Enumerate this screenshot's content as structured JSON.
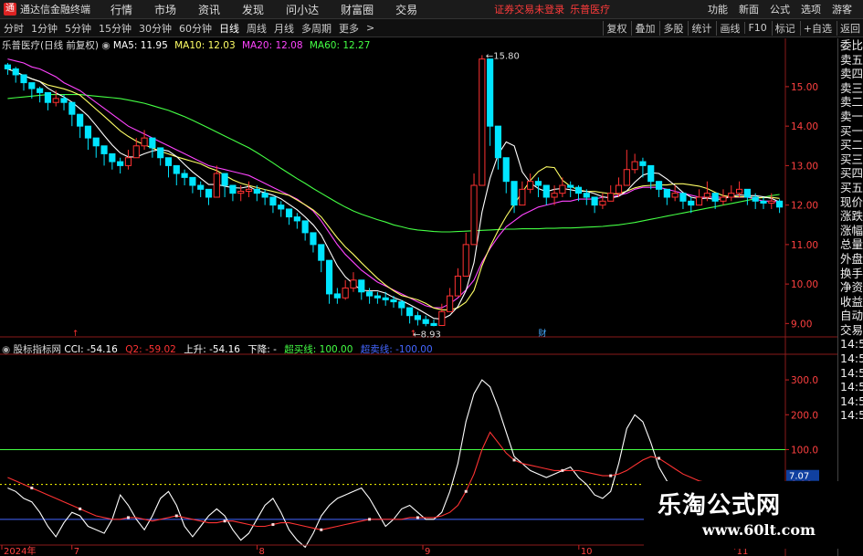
{
  "titlebar": {
    "app_name": "通达信金融终端",
    "menu": [
      "行情",
      "市场",
      "资讯",
      "发现",
      "问小达",
      "财富圈",
      "交易"
    ],
    "notice": "证券交易未登录",
    "stock_link": "乐普医疗",
    "right_items": [
      "功能",
      "新面",
      "公式",
      "选项",
      "游客"
    ]
  },
  "toolbar": {
    "periods": [
      "分时",
      "1分钟",
      "5分钟",
      "15分钟",
      "30分钟",
      "60分钟",
      "日线",
      "周线",
      "月线",
      "多周期",
      "更多"
    ],
    "active_period": "日线",
    "right_items": [
      "复权",
      "叠加",
      "多股",
      "统计",
      "画线",
      "F10",
      "标记",
      "+自选",
      "返回"
    ]
  },
  "ma_legend": {
    "title": "乐普医疗(日线 前复权)",
    "items": [
      {
        "text": "MA5: 11.95",
        "color": "#ffffff"
      },
      {
        "text": "MA10: 12.03",
        "color": "#ffff66"
      },
      {
        "text": "MA20: 12.08",
        "color": "#ff44ff"
      },
      {
        "text": "MA60: 12.27",
        "color": "#44ff44"
      }
    ]
  },
  "cci_legend": {
    "title": "股标指标网",
    "items": [
      {
        "text": "CCI: -54.16",
        "color": "#ffffff"
      },
      {
        "text": "Q2: -59.02",
        "color": "#ff3333"
      },
      {
        "text": "上升: -54.16",
        "color": "#ffffff"
      },
      {
        "text": "下降: -",
        "color": "#ffffff"
      },
      {
        "text": "超买线: 100.00",
        "color": "#44ff44"
      },
      {
        "text": "超卖线: -100.00",
        "color": "#4466ff"
      }
    ]
  },
  "price_axis": [
    "15.00",
    "14.00",
    "13.00",
    "12.00",
    "11.00",
    "10.00",
    "9.00"
  ],
  "cci_axis": [
    "300.0",
    "200.0",
    "100.0",
    "0.00"
  ],
  "cci_cursor_value": "7.07",
  "annotations": {
    "high": "15.80",
    "low": "8.93"
  },
  "date_axis": [
    "2024年",
    "7",
    "8",
    "9",
    "10",
    "11"
  ],
  "markers": {
    "m1": "↑",
    "m2": "财"
  },
  "right_panel": [
    "委比",
    "卖五",
    "卖四",
    "卖三",
    "卖二",
    "卖一",
    "买一",
    "买二",
    "买三",
    "买四",
    "买五",
    "现价",
    "涨跌",
    "涨幅",
    "总量",
    "外盘",
    "换手",
    "净资",
    "收益",
    "自动",
    "交易",
    "14:50",
    "14:50",
    "14:50",
    "14:50",
    "14:50",
    "14:50"
  ],
  "watermark": {
    "big": "乐淘公式网",
    "small": "www.60lt.com"
  },
  "colors": {
    "up": "#ff3232",
    "down": "#00e5ff",
    "ma5": "#ffffff",
    "ma10": "#ffff66",
    "ma20": "#ff44ff",
    "ma60": "#44ff44"
  },
  "chart_data": [
    {
      "type": "candlestick",
      "title": "乐普医疗(日线 前复权)",
      "ylim": [
        8.8,
        15.9
      ],
      "yticks": [
        9,
        10,
        11,
        12,
        13,
        14,
        15
      ],
      "x_month_labels": [
        "2024年",
        "7",
        "8",
        "9",
        "10",
        "11"
      ],
      "close": [
        15.45,
        15.3,
        15.1,
        14.95,
        14.85,
        14.6,
        14.7,
        14.6,
        14.3,
        14.0,
        13.7,
        13.5,
        13.3,
        13.1,
        13.0,
        13.2,
        13.5,
        13.7,
        13.45,
        13.2,
        13.0,
        12.8,
        12.7,
        12.5,
        12.4,
        12.2,
        12.8,
        12.5,
        12.3,
        12.35,
        12.4,
        12.3,
        12.2,
        12.0,
        11.9,
        11.7,
        11.6,
        11.3,
        11.0,
        10.6,
        9.75,
        9.65,
        9.9,
        10.1,
        9.8,
        9.7,
        9.65,
        9.6,
        9.55,
        9.4,
        9.2,
        9.1,
        9.0,
        8.95,
        9.3,
        9.7,
        10.2,
        11.0,
        12.5,
        15.7,
        14.0,
        13.2,
        12.6,
        12.0,
        12.4,
        12.6,
        12.5,
        12.2,
        12.3,
        12.5,
        12.45,
        12.3,
        12.2,
        12.0,
        12.1,
        12.3,
        12.5,
        12.9,
        13.1,
        13.0,
        12.6,
        12.4,
        12.2,
        12.3,
        12.1,
        12.0,
        12.2,
        12.3,
        12.1,
        12.2,
        12.3,
        12.4,
        12.2,
        12.1,
        12.05,
        12.1,
        11.95
      ],
      "high": [
        15.6,
        15.5,
        15.3,
        15.1,
        15.0,
        14.8,
        14.9,
        14.8,
        14.5,
        14.2,
        13.9,
        13.7,
        13.5,
        13.3,
        13.2,
        13.4,
        13.7,
        13.9,
        13.6,
        13.4,
        13.2,
        13.0,
        12.9,
        12.7,
        12.6,
        12.4,
        13.0,
        12.7,
        12.5,
        12.5,
        12.6,
        12.5,
        12.4,
        12.2,
        12.1,
        11.9,
        11.8,
        11.5,
        11.2,
        10.8,
        10.0,
        9.9,
        10.1,
        10.3,
        10.0,
        9.9,
        9.8,
        9.8,
        9.7,
        9.6,
        9.4,
        9.3,
        9.2,
        9.1,
        9.5,
        9.9,
        10.4,
        11.3,
        12.8,
        15.8,
        15.0,
        13.5,
        12.9,
        12.4,
        12.6,
        12.8,
        12.7,
        12.5,
        12.5,
        12.7,
        12.6,
        12.5,
        12.4,
        12.2,
        12.3,
        12.5,
        12.7,
        13.4,
        13.3,
        13.2,
        12.8,
        12.6,
        12.4,
        12.5,
        12.3,
        12.2,
        12.4,
        12.6,
        12.3,
        12.4,
        12.5,
        12.6,
        12.4,
        12.3,
        12.2,
        12.3,
        12.15
      ],
      "low": [
        15.3,
        15.1,
        14.9,
        14.7,
        14.6,
        14.4,
        14.5,
        14.4,
        14.0,
        13.7,
        13.4,
        13.2,
        13.0,
        12.9,
        12.8,
        12.9,
        13.2,
        13.4,
        13.2,
        13.0,
        12.7,
        12.5,
        12.5,
        12.3,
        12.2,
        12.0,
        12.4,
        12.2,
        12.1,
        12.1,
        12.2,
        12.1,
        12.0,
        11.8,
        11.7,
        11.5,
        11.4,
        11.1,
        10.8,
        10.3,
        9.5,
        9.5,
        9.6,
        9.8,
        9.6,
        9.5,
        9.5,
        9.45,
        9.4,
        9.2,
        9.0,
        8.95,
        8.93,
        8.93,
        9.1,
        9.4,
        9.9,
        10.6,
        11.5,
        12.5,
        13.5,
        12.9,
        12.3,
        11.8,
        12.0,
        12.3,
        12.2,
        12.0,
        12.0,
        12.2,
        12.2,
        12.1,
        12.0,
        11.8,
        11.9,
        12.1,
        12.2,
        12.7,
        12.8,
        12.7,
        12.4,
        12.2,
        12.0,
        12.1,
        11.9,
        11.8,
        12.0,
        12.1,
        11.9,
        12.0,
        12.1,
        12.2,
        12.0,
        11.9,
        11.9,
        11.9,
        11.8
      ],
      "ma20": [
        15.7,
        15.65,
        15.6,
        15.5,
        15.45,
        15.35,
        15.25,
        15.1,
        15.0,
        14.9,
        14.75,
        14.6,
        14.45,
        14.3,
        14.15,
        14.0,
        13.9,
        13.8,
        13.7,
        13.6,
        13.5,
        13.4,
        13.3,
        13.2,
        13.1,
        13.0,
        12.95,
        12.9,
        12.85,
        12.8,
        12.75,
        12.65,
        12.55,
        12.45,
        12.35,
        12.25,
        12.15,
        12.0,
        11.85,
        11.6,
        11.3,
        11.0,
        10.75,
        10.55,
        10.35,
        10.2,
        10.05,
        9.95,
        9.85,
        9.75,
        9.65,
        9.55,
        9.45,
        9.4,
        9.4,
        9.5,
        9.65,
        9.85,
        10.1,
        10.55,
        10.9,
        11.2,
        11.45,
        11.6,
        11.75,
        11.85,
        11.95,
        12.0,
        12.05,
        12.1,
        12.1,
        12.15,
        12.15,
        12.15,
        12.2,
        12.2,
        12.25,
        12.3,
        12.4,
        12.45,
        12.45,
        12.45,
        12.4,
        12.35,
        12.3,
        12.25,
        12.2,
        12.2,
        12.2,
        12.2,
        12.2,
        12.2,
        12.2,
        12.15,
        12.1,
        12.1,
        12.08
      ],
      "ma60": [
        14.7,
        14.72,
        14.74,
        14.76,
        14.78,
        14.8,
        14.8,
        14.8,
        14.8,
        14.8,
        14.78,
        14.76,
        14.74,
        14.72,
        14.7,
        14.66,
        14.62,
        14.58,
        14.52,
        14.46,
        14.4,
        14.32,
        14.24,
        14.15,
        14.05,
        13.95,
        13.85,
        13.75,
        13.65,
        13.55,
        13.45,
        13.33,
        13.2,
        13.07,
        12.93,
        12.8,
        12.67,
        12.55,
        12.42,
        12.3,
        12.18,
        12.06,
        11.95,
        11.85,
        11.77,
        11.7,
        11.63,
        11.57,
        11.5,
        11.45,
        11.4,
        11.37,
        11.35,
        11.33,
        11.32,
        11.32,
        11.33,
        11.34,
        11.35,
        11.36,
        11.37,
        11.38,
        11.39,
        11.39,
        11.4,
        11.4,
        11.4,
        11.41,
        11.41,
        11.42,
        11.42,
        11.43,
        11.44,
        11.45,
        11.46,
        11.48,
        11.5,
        11.53,
        11.56,
        11.6,
        11.64,
        11.68,
        11.72,
        11.76,
        11.8,
        11.84,
        11.88,
        11.92,
        11.96,
        12.0,
        12.04,
        12.08,
        12.12,
        12.16,
        12.2,
        12.24,
        12.27
      ]
    },
    {
      "type": "line",
      "title": "股标指标网",
      "ylim": [
        -200,
        350
      ],
      "yticks": [
        300,
        200,
        100,
        0
      ],
      "series": [
        {
          "name": "CCI",
          "color": "#ffffff",
          "values": [
            -10,
            -20,
            -40,
            -50,
            -80,
            -120,
            -150,
            -110,
            -80,
            -90,
            -120,
            -130,
            -140,
            -100,
            -30,
            -60,
            -100,
            -130,
            -90,
            -40,
            -20,
            -60,
            -120,
            -150,
            -120,
            -90,
            -70,
            -90,
            -130,
            -160,
            -140,
            -100,
            -60,
            -40,
            -80,
            -130,
            -160,
            -180,
            -140,
            -90,
            -60,
            -40,
            -30,
            -20,
            -10,
            -40,
            -80,
            -120,
            -100,
            -70,
            -60,
            -80,
            -100,
            -100,
            -80,
            -20,
            60,
            180,
            260,
            300,
            280,
            220,
            150,
            80,
            60,
            40,
            30,
            20,
            30,
            40,
            50,
            20,
            0,
            -30,
            -40,
            -20,
            60,
            160,
            200,
            180,
            120,
            50,
            10,
            -10,
            -30,
            -60,
            -80,
            -70,
            -50,
            -40,
            -20,
            -60,
            -50,
            -40,
            -30,
            -40,
            -54
          ]
        },
        {
          "name": "Q2",
          "color": "#ff3333",
          "values": [
            20,
            10,
            0,
            -10,
            -20,
            -30,
            -40,
            -50,
            -60,
            -70,
            -80,
            -90,
            -95,
            -100,
            -100,
            -95,
            -95,
            -100,
            -105,
            -100,
            -95,
            -90,
            -95,
            -100,
            -105,
            -110,
            -110,
            -105,
            -105,
            -110,
            -115,
            -120,
            -120,
            -115,
            -110,
            -110,
            -115,
            -120,
            -125,
            -130,
            -125,
            -120,
            -115,
            -110,
            -105,
            -100,
            -100,
            -100,
            -100,
            -100,
            -95,
            -95,
            -95,
            -95,
            -90,
            -80,
            -60,
            -20,
            30,
            100,
            150,
            120,
            90,
            70,
            60,
            55,
            50,
            45,
            40,
            40,
            40,
            40,
            35,
            30,
            25,
            25,
            30,
            40,
            55,
            70,
            80,
            75,
            60,
            45,
            30,
            20,
            10,
            5,
            0,
            -10,
            -20,
            -30,
            -35,
            -40,
            -45,
            -50,
            -59
          ]
        }
      ],
      "reference_lines": [
        {
          "name": "超买线",
          "value": 100,
          "color": "#44ff44"
        },
        {
          "name": "超卖线",
          "value": -100,
          "color": "#4466ff"
        },
        {
          "name": "zero",
          "value": 0,
          "color": "#ffff00",
          "style": "dotted"
        }
      ]
    }
  ]
}
